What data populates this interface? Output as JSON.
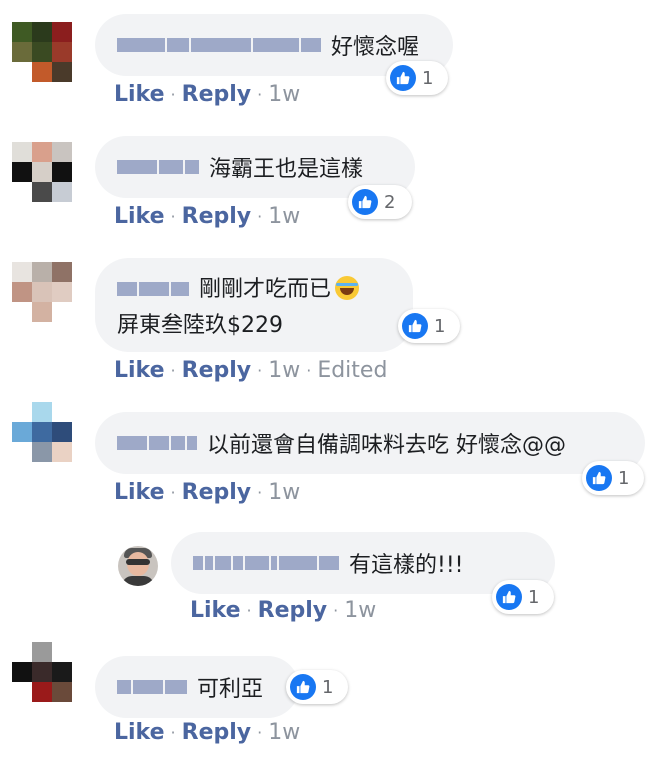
{
  "comments": [
    {
      "text": "好懷念喔",
      "reaction_count": "1",
      "actions": {
        "like": "Like",
        "reply": "Reply",
        "time": "1w",
        "edited": ""
      }
    },
    {
      "text": "海霸王也是這樣",
      "reaction_count": "2",
      "actions": {
        "like": "Like",
        "reply": "Reply",
        "time": "1w",
        "edited": ""
      }
    },
    {
      "text_line1": "剛剛才吃而已",
      "text_line2": "屏東叁陸玖$229",
      "emoji": "face-with-tears-of-joy",
      "reaction_count": "1",
      "actions": {
        "like": "Like",
        "reply": "Reply",
        "time": "1w",
        "edited": "Edited"
      }
    },
    {
      "text": "以前還會自備調味料去吃 好懷念@@",
      "reaction_count": "1",
      "actions": {
        "like": "Like",
        "reply": "Reply",
        "time": "1w",
        "edited": ""
      }
    },
    {
      "text": "有這樣的!!!",
      "reaction_count": "1",
      "actions": {
        "like": "Like",
        "reply": "Reply",
        "time": "1w",
        "edited": ""
      }
    },
    {
      "text": "可利亞",
      "reaction_count": "1",
      "actions": {
        "like": "Like",
        "reply": "Reply",
        "time": "1w",
        "edited": ""
      }
    }
  ],
  "colors": {
    "bubble": "#f2f3f5",
    "link": "#4b66a0",
    "like": "#1877f2",
    "meta": "#8d949e"
  },
  "icons": {
    "reaction": "thumbs-up-icon",
    "dot": "middle-dot"
  }
}
